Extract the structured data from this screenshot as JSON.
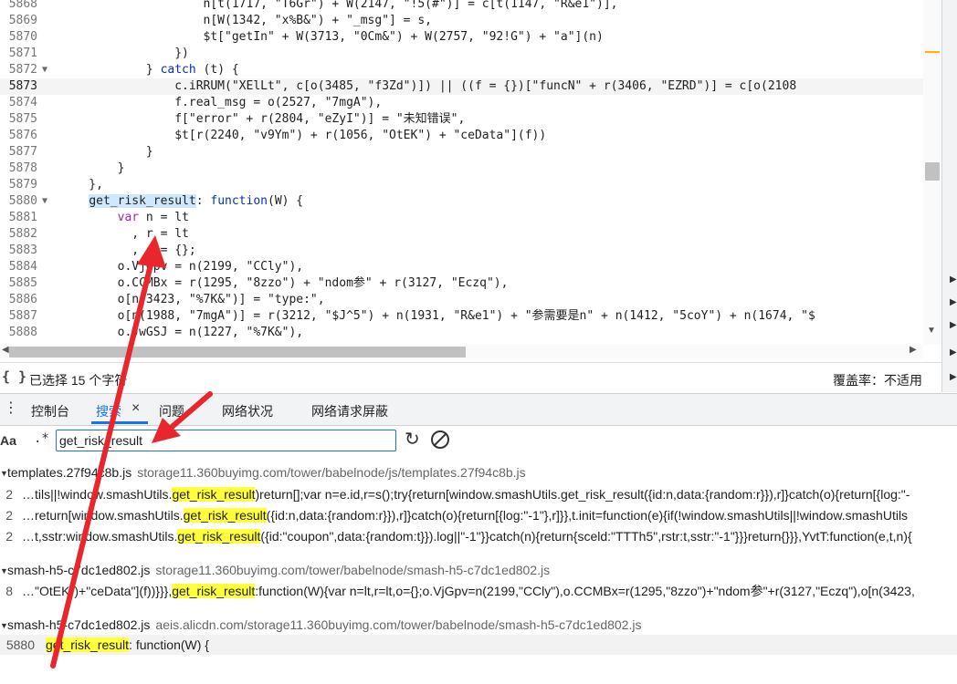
{
  "editor": {
    "lines": [
      {
        "num": "5868",
        "fold": "",
        "active": false,
        "segs": [
          {
            "t": "                    n[t(1717, \"T6Gr\") + W(2147, \"!5(#\")] = c[t(1147, \"R&e1\")],",
            "c": ""
          }
        ]
      },
      {
        "num": "5869",
        "fold": "",
        "active": false,
        "segs": [
          {
            "t": "                    n[W(1342, \"x%B&\") + \"_msg\"] = s,",
            "c": ""
          }
        ]
      },
      {
        "num": "5870",
        "fold": "",
        "active": false,
        "segs": [
          {
            "t": "                    $t[\"getIn\" + W(3713, \"0Cm&\") + W(2757, \"92!G\") + \"a\"](n)",
            "c": ""
          }
        ]
      },
      {
        "num": "5871",
        "fold": "",
        "active": false,
        "segs": [
          {
            "t": "                })",
            "c": ""
          }
        ]
      },
      {
        "num": "5872",
        "fold": "▼",
        "active": false,
        "segs": [
          {
            "t": "            } ",
            "c": ""
          },
          {
            "t": "catch",
            "c": "kb"
          },
          {
            "t": " (t) {",
            "c": ""
          }
        ]
      },
      {
        "num": "5873",
        "fold": "",
        "active": true,
        "segs": [
          {
            "t": "                c.iRRUM(\"XElLt\", c[o(3485, \"f3Zd\")]) || ((f = {})[\"funcN\" + r(3406, \"EZRD\")] = c[o(2108",
            "c": ""
          }
        ]
      },
      {
        "num": "5874",
        "fold": "",
        "active": false,
        "segs": [
          {
            "t": "                f.real_msg = o(2527, \"7mgA\"),",
            "c": ""
          }
        ]
      },
      {
        "num": "5875",
        "fold": "",
        "active": false,
        "segs": [
          {
            "t": "                f[\"error\" + r(2804, \"eZyI\")] = \"未知错误\",",
            "c": ""
          }
        ]
      },
      {
        "num": "5876",
        "fold": "",
        "active": false,
        "segs": [
          {
            "t": "                $t[r(2240, \"v9Ym\") + r(1056, \"OtEK\") + \"ceData\"](f))",
            "c": ""
          }
        ]
      },
      {
        "num": "5877",
        "fold": "",
        "active": false,
        "segs": [
          {
            "t": "            }",
            "c": ""
          }
        ]
      },
      {
        "num": "5878",
        "fold": "",
        "active": false,
        "segs": [
          {
            "t": "        }",
            "c": ""
          }
        ]
      },
      {
        "num": "5879",
        "fold": "",
        "active": false,
        "segs": [
          {
            "t": "    },",
            "c": ""
          }
        ]
      },
      {
        "num": "5880",
        "fold": "▼",
        "active": false,
        "segs": [
          {
            "t": "    ",
            "c": ""
          },
          {
            "t": "get_risk_result",
            "c": "hl-sel"
          },
          {
            "t": ": ",
            "c": ""
          },
          {
            "t": "function",
            "c": "kb"
          },
          {
            "t": "(W) {",
            "c": ""
          }
        ]
      },
      {
        "num": "5881",
        "fold": "",
        "active": false,
        "segs": [
          {
            "t": "        ",
            "c": ""
          },
          {
            "t": "var",
            "c": "k"
          },
          {
            "t": " n = lt",
            "c": ""
          }
        ]
      },
      {
        "num": "5882",
        "fold": "",
        "active": false,
        "segs": [
          {
            "t": "          , r = lt",
            "c": ""
          }
        ]
      },
      {
        "num": "5883",
        "fold": "",
        "active": false,
        "segs": [
          {
            "t": "          , o = {};",
            "c": ""
          }
        ]
      },
      {
        "num": "5884",
        "fold": "",
        "active": false,
        "segs": [
          {
            "t": "        o.VjGpv = n(2199, \"CCly\"),",
            "c": ""
          }
        ]
      },
      {
        "num": "5885",
        "fold": "",
        "active": false,
        "segs": [
          {
            "t": "        o.CCMBx = r(1295, \"8zzo\") + \"ndom参\" + r(3127, \"Eczq\"),",
            "c": ""
          }
        ]
      },
      {
        "num": "5886",
        "fold": "",
        "active": false,
        "segs": [
          {
            "t": "        o[n(3423, \"%7K&\")] = \"type:\",",
            "c": ""
          }
        ]
      },
      {
        "num": "5887",
        "fold": "",
        "active": false,
        "segs": [
          {
            "t": "        o[n(1988, \"7mgA\")] = r(3212, \"$J^5\") + n(1931, \"R&e1\") + \"参需要是n\" + n(1412, \"5coY\") + n(1674, \"$",
            "c": ""
          }
        ]
      },
      {
        "num": "5888",
        "fold": "",
        "active": false,
        "segs": [
          {
            "t": "        o.JwGSJ = n(1227, \"%7K&\"),",
            "c": ""
          }
        ]
      }
    ]
  },
  "statusbar": {
    "selection_text": "已选择 15 个字符",
    "coverage_text": "覆盖率：不适用"
  },
  "drawer": {
    "tabs": [
      {
        "label": "控制台"
      },
      {
        "label": "搜索"
      },
      {
        "label": "问题"
      },
      {
        "label": "网络状况"
      },
      {
        "label": "网络请求屏蔽"
      }
    ],
    "close_glyph": "×"
  },
  "search": {
    "match_case_label": "Aa",
    "regex_label": ".*",
    "query": "get_risk_result"
  },
  "results": {
    "files": [
      {
        "name": "templates.27f94c8b.js",
        "path": "storage11.360buyimg.com/tower/babelnode/js/templates.27f94c8b.js",
        "lines": [
          {
            "num": "2",
            "pre": "…tils||!window.smashUtils.",
            "match": "get_risk_result",
            "post": ")return[];var n=e.id,r=s();try{return[window.smashUtils.get_risk_result({id:n,data:{random:r}}),r]}catch(o){return[{log:\"-"
          },
          {
            "num": "2",
            "pre": "…return[window.smashUtils.",
            "match": "get_risk_result",
            "post": "({id:n,data:{random:r}}),r]}catch(o){return[{log:\"-1\"},r]}},t.init=function(e){if(!window.smashUtils||!window.smashUtils"
          },
          {
            "num": "2",
            "pre": "…t,sstr:window.smashUtils.",
            "match": "get_risk_result",
            "post": "({id:\"coupon\",data:{random:t}}).log||\"-1\"}}catch(n){return{sceld:\"TTTh5\",rstr:t,sstr:\"-1\"}}}return{}}},YvtT:function(e,t,n){"
          }
        ]
      },
      {
        "name": "smash-h5-c7dc1ed802.js",
        "path": "storage11.360buyimg.com/tower/babelnode/smash-h5-c7dc1ed802.js",
        "lines": [
          {
            "num": "8",
            "pre": "…\"OtEK\")+\"ceData\"](f))}}},",
            "match": "get_risk_result",
            "post": ":function(W){var n=lt,r=lt,o={};o.VjGpv=n(2199,\"CCly\"),o.CCMBx=r(1295,\"8zzo\")+\"ndom参\"+r(3127,\"Eczq\"),o[n(3423,"
          }
        ]
      },
      {
        "name": "smash-h5-c7dc1ed802.js",
        "path": "aeis.alicdn.com/storage11.360buyimg.com/tower/babelnode/smash-h5-c7dc1ed802.js",
        "lines": [
          {
            "num": "5880",
            "pre": "",
            "match": "get_risk_result",
            "post": ": function(W) {"
          }
        ]
      }
    ]
  },
  "icons": {
    "fold": "fold-triangle-icon",
    "brace": "curly-braces-icon",
    "menu": "kebab-menu-icon",
    "refresh": "refresh-icon",
    "clear": "clear-icon"
  },
  "colors": {
    "accent": "#1a73e8",
    "match_highlight": "#ffff3b",
    "selection_highlight": "#cfe8fc",
    "annotation_arrow": "#e8262b"
  }
}
